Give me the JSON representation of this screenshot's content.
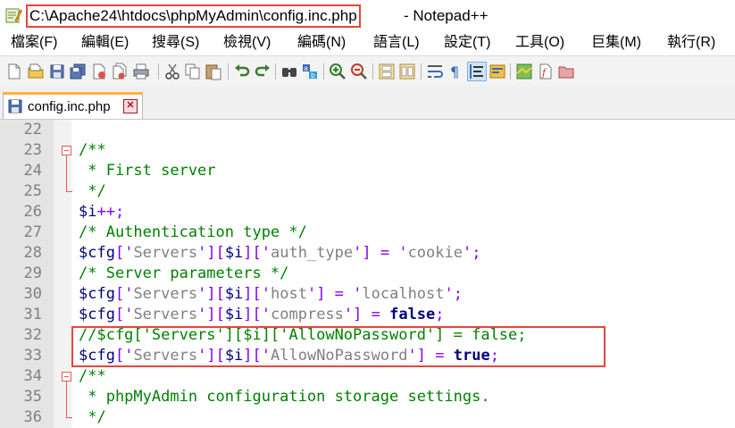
{
  "window": {
    "title_path": "C:\\Apache24\\htdocs\\phpMyAdmin\\config.inc.php",
    "title_suffix": "- Notepad++",
    "app_icon": "notepadpp-icon"
  },
  "menu": [
    {
      "label": "檔案(F)"
    },
    {
      "label": "編輯(E)"
    },
    {
      "label": "搜尋(S)"
    },
    {
      "label": "檢視(V)"
    },
    {
      "label": "編碼(N)"
    },
    {
      "label": "語言(L)"
    },
    {
      "label": "設定(T)"
    },
    {
      "label": "工具(O)"
    },
    {
      "label": "巨集(M)"
    },
    {
      "label": "執行(R)"
    }
  ],
  "toolbar": [
    "new-file-icon",
    "open-file-icon",
    "save-icon",
    "save-all-icon",
    "close-icon",
    "close-all-icon",
    "print-icon",
    "cut-icon",
    "copy-icon",
    "paste-icon",
    "undo-icon",
    "redo-icon",
    "find-icon",
    "replace-icon",
    "zoom-in-icon",
    "zoom-out-icon",
    "sync-vertical-icon",
    "sync-horizontal-icon",
    "word-wrap-icon",
    "show-all-chars-icon",
    "indent-guide-icon",
    "udl-icon",
    "doc-map-icon",
    "function-list-icon",
    "folder-workspace-icon"
  ],
  "tab": {
    "label": "config.inc.php",
    "close_glyph": "✕",
    "icon": "saved-file-icon"
  },
  "colors": {
    "comment": "#008000",
    "variable": "#000080",
    "string": "#808080",
    "operator": "#8000ff",
    "keyword": "#000080",
    "annotation_red": "#e8453c",
    "active_tab_accent": "#ffb140"
  },
  "editor": {
    "lines": [
      {
        "n": "22",
        "tokens": []
      },
      {
        "n": "23",
        "fold": "open",
        "tokens": [
          {
            "t": "/**",
            "c": "c-comment"
          }
        ]
      },
      {
        "n": "24",
        "tokens": [
          {
            "t": " * First server",
            "c": "c-comment"
          }
        ]
      },
      {
        "n": "25",
        "fold": "end",
        "tokens": [
          {
            "t": " */",
            "c": "c-comment"
          }
        ]
      },
      {
        "n": "26",
        "tokens": [
          {
            "t": "$i",
            "c": "c-var"
          },
          {
            "t": "++;",
            "c": "c-op"
          }
        ]
      },
      {
        "n": "27",
        "tokens": [
          {
            "t": "/* Authentication type */",
            "c": "c-comment"
          }
        ]
      },
      {
        "n": "28",
        "tokens": [
          {
            "t": "$cfg",
            "c": "c-var"
          },
          {
            "t": "['",
            "c": "c-op"
          },
          {
            "t": "Servers",
            "c": "c-str"
          },
          {
            "t": "'][",
            "c": "c-op"
          },
          {
            "t": "$i",
            "c": "c-var"
          },
          {
            "t": "]['",
            "c": "c-op"
          },
          {
            "t": "auth_type",
            "c": "c-str"
          },
          {
            "t": "'] = '",
            "c": "c-op"
          },
          {
            "t": "cookie",
            "c": "c-str"
          },
          {
            "t": "';",
            "c": "c-op"
          }
        ]
      },
      {
        "n": "29",
        "tokens": [
          {
            "t": "/* Server parameters */",
            "c": "c-comment"
          }
        ]
      },
      {
        "n": "30",
        "tokens": [
          {
            "t": "$cfg",
            "c": "c-var"
          },
          {
            "t": "['",
            "c": "c-op"
          },
          {
            "t": "Servers",
            "c": "c-str"
          },
          {
            "t": "'][",
            "c": "c-op"
          },
          {
            "t": "$i",
            "c": "c-var"
          },
          {
            "t": "]['",
            "c": "c-op"
          },
          {
            "t": "host",
            "c": "c-str"
          },
          {
            "t": "'] = '",
            "c": "c-op"
          },
          {
            "t": "localhost",
            "c": "c-str"
          },
          {
            "t": "';",
            "c": "c-op"
          }
        ]
      },
      {
        "n": "31",
        "tokens": [
          {
            "t": "$cfg",
            "c": "c-var"
          },
          {
            "t": "['",
            "c": "c-op"
          },
          {
            "t": "Servers",
            "c": "c-str"
          },
          {
            "t": "'][",
            "c": "c-op"
          },
          {
            "t": "$i",
            "c": "c-var"
          },
          {
            "t": "]['",
            "c": "c-op"
          },
          {
            "t": "compress",
            "c": "c-str"
          },
          {
            "t": "'] = ",
            "c": "c-op"
          },
          {
            "t": "false",
            "c": "c-kw"
          },
          {
            "t": ";",
            "c": "c-op"
          }
        ]
      },
      {
        "n": "32",
        "tokens": [
          {
            "t": "//$cfg['Servers'][$i]['AllowNoPassword'] = false;",
            "c": "c-comment"
          }
        ]
      },
      {
        "n": "33",
        "tokens": [
          {
            "t": "$cfg",
            "c": "c-var"
          },
          {
            "t": "['",
            "c": "c-op"
          },
          {
            "t": "Servers",
            "c": "c-str"
          },
          {
            "t": "'][",
            "c": "c-op"
          },
          {
            "t": "$i",
            "c": "c-var"
          },
          {
            "t": "]['",
            "c": "c-op"
          },
          {
            "t": "AllowNoPassword",
            "c": "c-str"
          },
          {
            "t": "'] = ",
            "c": "c-op"
          },
          {
            "t": "true",
            "c": "c-kw"
          },
          {
            "t": ";",
            "c": "c-op"
          }
        ]
      },
      {
        "n": "34",
        "fold": "open",
        "tokens": [
          {
            "t": "/**",
            "c": "c-comment"
          }
        ]
      },
      {
        "n": "35",
        "tokens": [
          {
            "t": " * phpMyAdmin configuration storage settings.",
            "c": "c-comment"
          }
        ]
      },
      {
        "n": "36",
        "fold": "end",
        "tokens": [
          {
            "t": " */",
            "c": "c-comment"
          }
        ]
      }
    ]
  }
}
